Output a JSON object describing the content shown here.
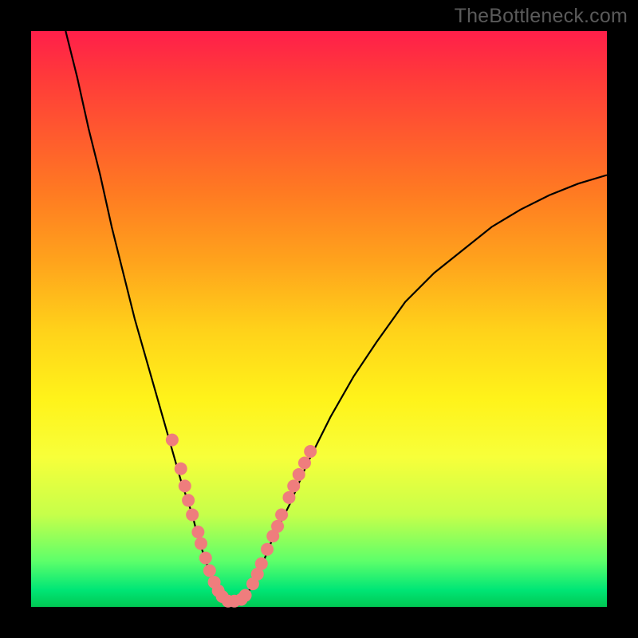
{
  "watermark": "TheBottleneck.com",
  "colors": {
    "frame_bg": "#000000",
    "curve": "#000000",
    "dot": "#ef7d7d",
    "gradient_top": "#ff1f4a",
    "gradient_bottom": "#00c853"
  },
  "chart_data": {
    "type": "line",
    "title": "",
    "xlabel": "",
    "ylabel": "",
    "xlim": [
      0,
      100
    ],
    "ylim": [
      0,
      100
    ],
    "grid": false,
    "legend": false,
    "series": [
      {
        "name": "curve",
        "x": [
          6,
          8,
          10,
          12,
          14,
          16,
          18,
          20,
          22,
          24,
          26,
          28,
          29,
          30,
          31,
          32,
          33,
          34,
          35,
          36,
          38,
          40,
          42,
          45,
          48,
          52,
          56,
          60,
          65,
          70,
          75,
          80,
          85,
          90,
          95,
          100
        ],
        "y": [
          100,
          92,
          83,
          75,
          66,
          58,
          50,
          43,
          36,
          29,
          22,
          16,
          12,
          9,
          6,
          4,
          2,
          1,
          0.6,
          1,
          3,
          7,
          12,
          18,
          25,
          33,
          40,
          46,
          53,
          58,
          62,
          66,
          69,
          71.5,
          73.5,
          75
        ]
      }
    ],
    "markers": [
      {
        "x": 24.5,
        "y": 29
      },
      {
        "x": 26.0,
        "y": 24
      },
      {
        "x": 26.7,
        "y": 21
      },
      {
        "x": 27.3,
        "y": 18.5
      },
      {
        "x": 28.0,
        "y": 16
      },
      {
        "x": 29.0,
        "y": 13
      },
      {
        "x": 29.5,
        "y": 11
      },
      {
        "x": 30.3,
        "y": 8.5
      },
      {
        "x": 31.0,
        "y": 6.3
      },
      {
        "x": 31.8,
        "y": 4.3
      },
      {
        "x": 32.5,
        "y": 2.8
      },
      {
        "x": 33.2,
        "y": 1.8
      },
      {
        "x": 34.2,
        "y": 1
      },
      {
        "x": 35.3,
        "y": 1
      },
      {
        "x": 36.5,
        "y": 1.3
      },
      {
        "x": 37.2,
        "y": 2
      },
      {
        "x": 38.5,
        "y": 4
      },
      {
        "x": 39.3,
        "y": 5.7
      },
      {
        "x": 40.0,
        "y": 7.5
      },
      {
        "x": 41.0,
        "y": 10
      },
      {
        "x": 42.0,
        "y": 12.3
      },
      {
        "x": 42.8,
        "y": 14
      },
      {
        "x": 43.5,
        "y": 16
      },
      {
        "x": 44.8,
        "y": 19
      },
      {
        "x": 45.6,
        "y": 21
      },
      {
        "x": 46.5,
        "y": 23
      },
      {
        "x": 47.5,
        "y": 25
      },
      {
        "x": 48.5,
        "y": 27
      }
    ]
  }
}
